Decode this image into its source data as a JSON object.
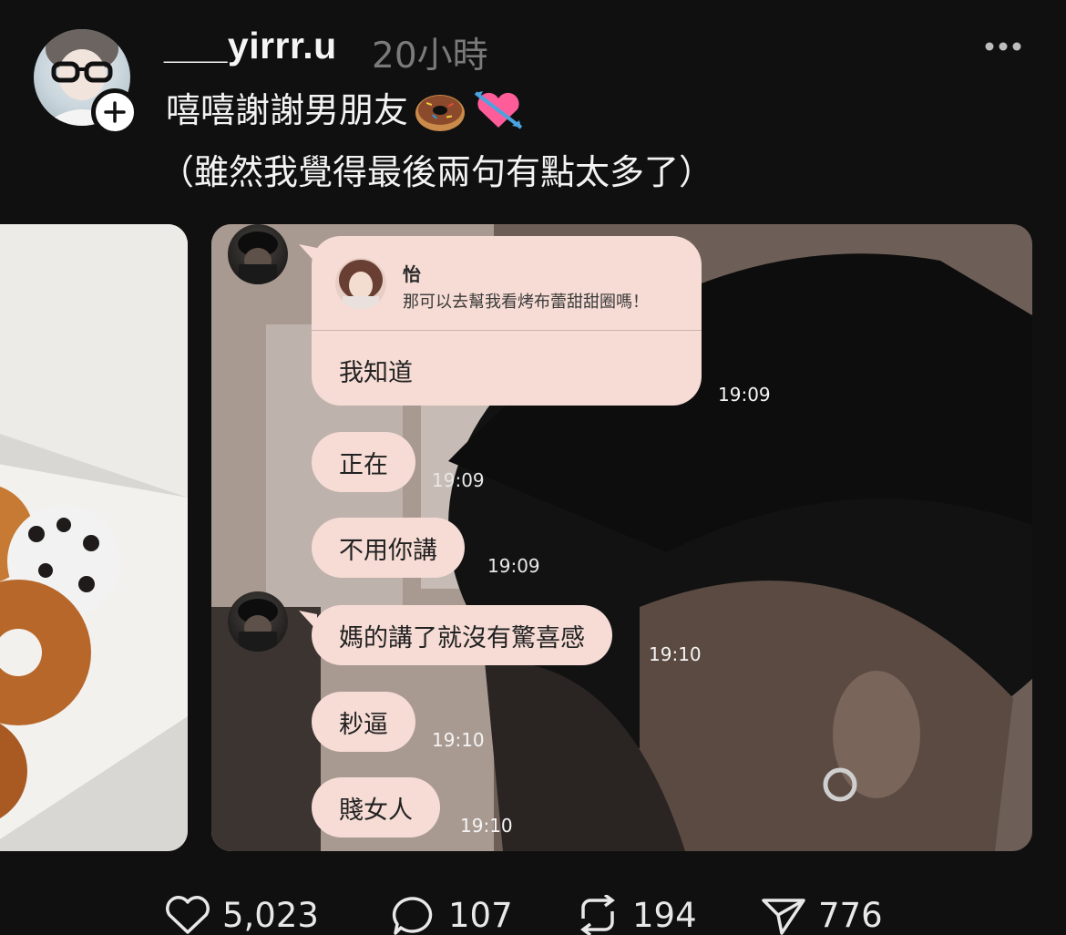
{
  "post": {
    "username": "___yirrr.u",
    "time": "20小時",
    "caption_line1": "嘻嘻謝謝男朋友",
    "caption_line2": "（雖然我覺得最後兩句有點太多了）",
    "caption_emojis": [
      "donut-icon",
      "heart-with-arrow-icon"
    ]
  },
  "chat": {
    "reply": {
      "quoted_name": "怡",
      "quoted_text": "那可以去幫我看烤布蕾甜甜圈嗎！",
      "text": "我知道",
      "time": "19:09"
    },
    "messages": [
      {
        "text": "正在",
        "time": "19:09"
      },
      {
        "text": "不用你講",
        "time": "19:09"
      },
      {
        "text": "媽的講了就沒有驚喜感",
        "time": "19:10"
      },
      {
        "text": "耖逼",
        "time": "19:10"
      },
      {
        "text": "賤女人",
        "time": "19:10"
      }
    ]
  },
  "actions": {
    "likes": "5,023",
    "comments": "107",
    "reposts": "194",
    "shares": "776"
  },
  "colors": {
    "background": "#101010",
    "bubble": "#f6dcd5",
    "muted_text": "#7a7a7a"
  }
}
